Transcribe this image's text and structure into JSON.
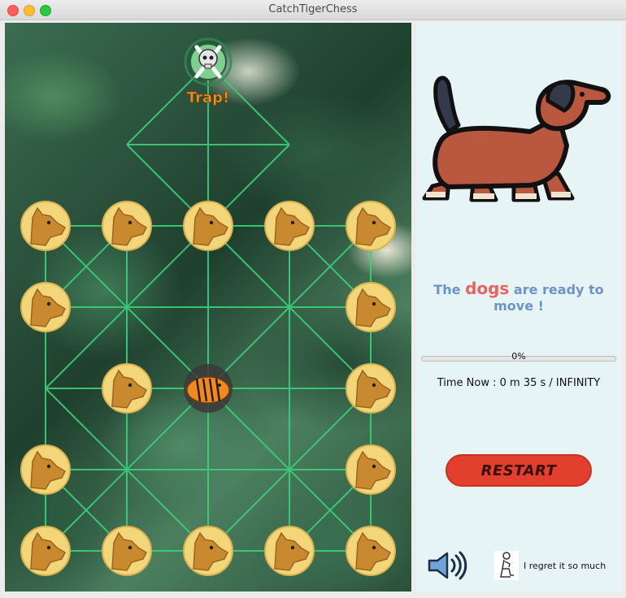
{
  "window": {
    "title": "CatchTigerChess"
  },
  "board": {
    "trap_label": "Trap!",
    "pieces": {
      "dogs": [
        [
          0,
          2
        ],
        [
          1,
          2
        ],
        [
          2,
          2
        ],
        [
          3,
          2
        ],
        [
          4,
          2
        ],
        [
          0,
          3
        ],
        [
          4,
          3
        ],
        [
          1,
          4
        ],
        [
          4,
          4
        ],
        [
          0,
          5
        ],
        [
          4,
          5
        ],
        [
          0,
          6
        ],
        [
          1,
          6
        ],
        [
          2,
          6
        ],
        [
          3,
          6
        ],
        [
          4,
          6
        ]
      ],
      "tiger": [
        2,
        4
      ]
    }
  },
  "side": {
    "message": {
      "prefix": "The",
      "highlight": "dogs",
      "suffix": "are ready to move !"
    },
    "progress": {
      "value": 0,
      "label": "0%"
    },
    "timer": "Time Now : 0 m 35 s / INFINITY",
    "restart_label": "RESTART",
    "regret_label": "I regret it so much"
  },
  "colors": {
    "line": "#39d17a",
    "dog_coin": "#f4d67a",
    "dog_face": "#c98a2f",
    "tiger": "#f08a1f",
    "restart": "#e23f2f",
    "message": "#6d93c8",
    "highlight": "#e8655d"
  }
}
